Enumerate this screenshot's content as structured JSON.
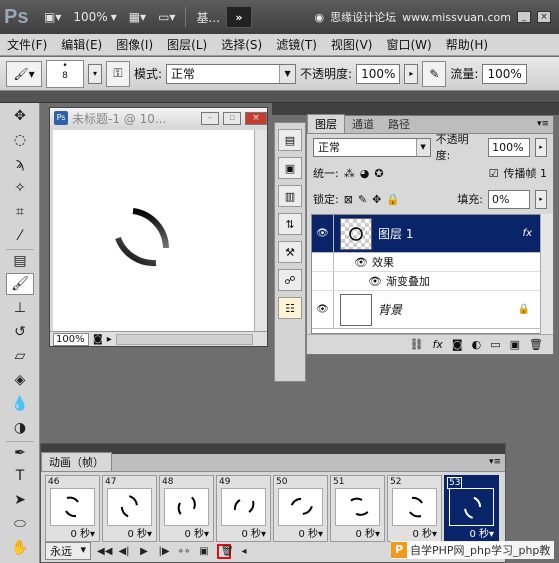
{
  "appbar": {
    "logo": "Ps",
    "zoom": "100%",
    "workspace": "基...",
    "expand": "»",
    "search_text": "思缘设计论坛",
    "site": "www.missvuan.com"
  },
  "menu": [
    "文件(F)",
    "编辑(E)",
    "图像(I)",
    "图层(L)",
    "选择(S)",
    "滤镜(T)",
    "视图(V)",
    "窗口(W)",
    "帮助(H)"
  ],
  "options": {
    "brush_size": "8",
    "mode_label": "模式:",
    "mode_value": "正常",
    "opacity_label": "不透明度:",
    "opacity_value": "100%",
    "flow_label": "流量:",
    "flow_value": "100%"
  },
  "document": {
    "title": "未标题-1 @ 10...",
    "zoom": "100%"
  },
  "layers_panel": {
    "tabs": [
      "图层",
      "通道",
      "路径"
    ],
    "blend_mode": "正常",
    "opacity_label": "不透明度:",
    "opacity_value": "100%",
    "unify_label": "统一:",
    "propagate_label": "传播帧 1",
    "lock_label": "锁定:",
    "fill_label": "填充:",
    "fill_value": "0%",
    "layers": [
      {
        "name": "图层 1",
        "selected": true
      },
      {
        "name": "背景",
        "selected": false
      }
    ],
    "effects_label": "效果",
    "effect_item": "渐变叠加",
    "fx": "fx"
  },
  "animation_panel": {
    "tab": "动画（帧）",
    "frames": [
      {
        "num": "46",
        "delay": "0 秒▾",
        "angle": 0
      },
      {
        "num": "47",
        "delay": "0 秒▾",
        "angle": 30
      },
      {
        "num": "48",
        "delay": "0 秒▾",
        "angle": 60
      },
      {
        "num": "49",
        "delay": "0 秒▾",
        "angle": 90
      },
      {
        "num": "50",
        "delay": "0 秒▾",
        "angle": 120
      },
      {
        "num": "51",
        "delay": "0 秒▾",
        "angle": 150
      },
      {
        "num": "52",
        "delay": "0 秒▾",
        "angle": 180
      },
      {
        "num": "53",
        "delay": "0 秒▾",
        "angle": 210
      }
    ],
    "loop": "永远"
  },
  "watermark": "自学PHP网_php学习_php教"
}
